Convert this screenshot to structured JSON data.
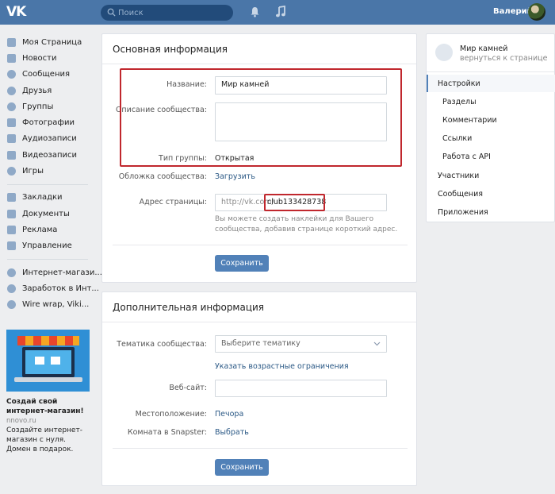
{
  "topbar": {
    "logo": "VK",
    "search_placeholder": "Поиск",
    "username": "Валерий"
  },
  "leftnav": {
    "items": [
      {
        "label": "Моя Страница",
        "icon": "home-icon"
      },
      {
        "label": "Новости",
        "icon": "news-icon"
      },
      {
        "label": "Сообщения",
        "icon": "chat-icon"
      },
      {
        "label": "Друзья",
        "icon": "person-icon"
      },
      {
        "label": "Группы",
        "icon": "people-icon"
      },
      {
        "label": "Фотографии",
        "icon": "camera-icon"
      },
      {
        "label": "Аудиозаписи",
        "icon": "music-icon"
      },
      {
        "label": "Видеозаписи",
        "icon": "video-icon"
      },
      {
        "label": "Игры",
        "icon": "gamepad-icon"
      }
    ],
    "items2": [
      {
        "label": "Закладки",
        "icon": "star-icon"
      },
      {
        "label": "Документы",
        "icon": "document-icon"
      },
      {
        "label": "Реклама",
        "icon": "megaphone-icon"
      },
      {
        "label": "Управление",
        "icon": "chart-icon"
      }
    ],
    "groups": [
      {
        "label": "Интернет-магази..."
      },
      {
        "label": "Заработок в Инт..."
      },
      {
        "label": "Wire wrap, Viki..."
      }
    ]
  },
  "ad": {
    "title": "Создай свой интернет-магазин!",
    "domain": "nnovo.ru",
    "text": "Создайте интернет-магазин с нуля. Домен в подарок."
  },
  "main_info": {
    "header": "Основная информация",
    "name_label": "Название:",
    "name_value": "Мир камней",
    "description_label": "Описание сообщества:",
    "description_value": "",
    "type_label": "Тип группы:",
    "type_value": "Открытая",
    "cover_label": "Обложка сообщества:",
    "cover_link": "Загрузить",
    "address_label": "Адрес страницы:",
    "address_prefix": "http://vk.com/",
    "address_value": "club133428738",
    "address_hint": "Вы можете создать наклейки для Вашего сообщества, добавив странице короткий адрес.",
    "save_label": "Сохранить"
  },
  "extra_info": {
    "header": "Дополнительная информация",
    "topic_label": "Тематика сообщества:",
    "topic_value": "Выберите тематику",
    "age_link": "Указать возрастные ограничения",
    "website_label": "Веб-сайт:",
    "website_value": "",
    "location_label": "Местоположение:",
    "location_value": "Печора",
    "snapster_label": "Комната в Snapster:",
    "snapster_link": "Выбрать",
    "save_label": "Сохранить"
  },
  "rightnav": {
    "back_title": "Мир камней",
    "back_sub": "вернуться к странице",
    "items": [
      "Настройки",
      "Разделы",
      "Комментарии",
      "Ссылки",
      "Работа с API",
      "Участники",
      "Сообщения",
      "Приложения"
    ]
  },
  "colors": {
    "topbar": "#4a76a8",
    "button": "#5181b8",
    "highlight": "#c0272d",
    "link": "#2a5885"
  }
}
